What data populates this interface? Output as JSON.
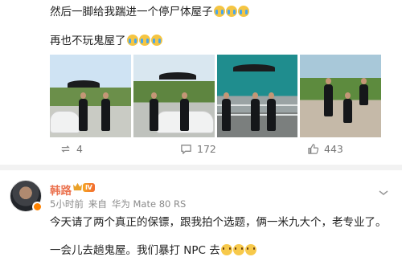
{
  "post": {
    "line1": "然后一脚给我踹进一个停尸体屋子",
    "line2": "再也不玩鬼屋了",
    "actions": {
      "repost_count": "4",
      "comment_count": "172",
      "like_count": "443"
    }
  },
  "comment": {
    "author": "韩路",
    "level": "Ⅳ",
    "time": "5小时前",
    "source_prefix": "来自",
    "source": "华为 Mate 80 RS",
    "text1": "今天请了两个真正的保镖，跟我拍个选题，俩一米九大个，老专业了。",
    "text2": "一会儿去趟鬼屋。我们暴打 NPC 去"
  },
  "colors": {
    "author_name": "#eb7350",
    "meta_text": "#8a8a8a",
    "verified_badge": "#ff8200"
  },
  "icons": {
    "repost": "repost-icon",
    "comment": "comment-icon",
    "like": "like-icon",
    "more": "more-icon",
    "crown": "crown-icon",
    "emoji_cry": "crying-emoji-icon",
    "emoji_laugh": "laughing-emoji-icon"
  }
}
